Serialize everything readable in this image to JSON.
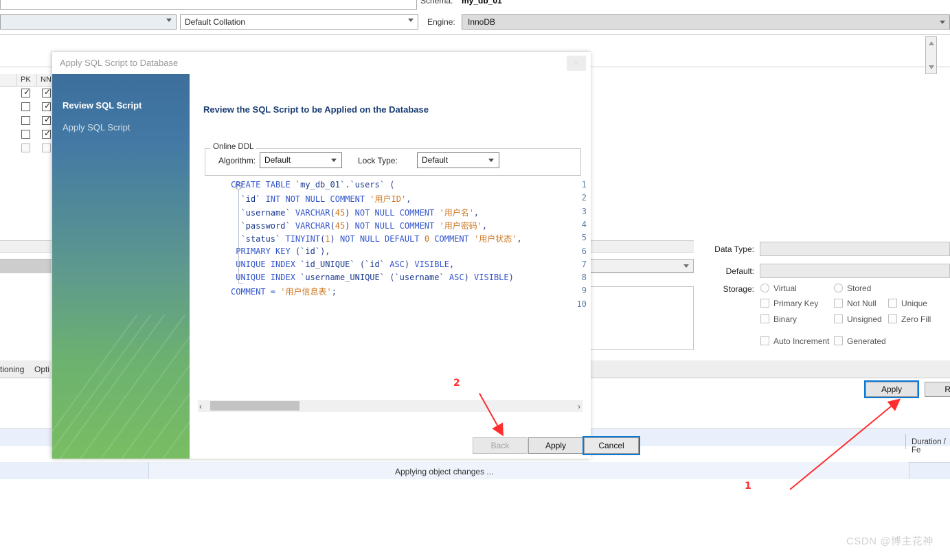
{
  "background_app": {
    "schema_label": "Schema:",
    "schema_value": "my_db_01",
    "engine_label": "Engine:",
    "engine_value": "InnoDB",
    "collation_value": "Default Collation",
    "grid": {
      "headers": [
        "PK",
        "NN"
      ],
      "rows": [
        {
          "pk": true,
          "nn": true,
          "dim": false
        },
        {
          "pk": false,
          "nn": true,
          "dim": false
        },
        {
          "pk": false,
          "nn": true,
          "dim": false
        },
        {
          "pk": false,
          "nn": true,
          "dim": false
        },
        {
          "pk": false,
          "nn": false,
          "dim": true
        }
      ]
    },
    "properties": {
      "data_type_label": "Data Type:",
      "data_type_value": "",
      "default_label": "Default:",
      "default_value": "",
      "storage_label": "Storage:",
      "radios": [
        "Virtual",
        "Stored"
      ],
      "checkboxes": [
        "Primary Key",
        "Not Null",
        "Unique",
        "Binary",
        "Unsigned",
        "Zero Fill",
        "Auto Increment",
        "Generated"
      ]
    },
    "tabs": [
      "tioning",
      "Opti"
    ],
    "apply_button": "Apply",
    "revert_button": "Rev",
    "duration_label": "Duration / Fe",
    "status_text": "Applying object changes ..."
  },
  "dialog": {
    "title": "Apply SQL Script to Database",
    "close_icon": "✕",
    "steps": [
      {
        "label": "Review SQL Script",
        "active": true
      },
      {
        "label": "Apply SQL Script",
        "active": false
      }
    ],
    "heading": "Review the SQL Script to be Applied on the Database",
    "online_ddl": {
      "legend": "Online DDL",
      "algorithm_label": "Algorithm:",
      "algorithm_value": "Default",
      "lock_type_label": "Lock Type:",
      "lock_type_value": "Default"
    },
    "code": {
      "line_numbers": [
        "1",
        "2",
        "3",
        "4",
        "5",
        "6",
        "7",
        "8",
        "9",
        "10"
      ],
      "lines": [
        [
          {
            "t": "CREATE TABLE ",
            "c": "kw"
          },
          {
            "t": "`my_db_01`",
            "c": "id"
          },
          {
            "t": ".",
            "c": "pl"
          },
          {
            "t": "`users`",
            "c": "id"
          },
          {
            "t": " (",
            "c": "pl"
          }
        ],
        [
          {
            "t": "  `id` ",
            "c": "id"
          },
          {
            "t": "INT NOT NULL COMMENT ",
            "c": "kw"
          },
          {
            "t": "'用户ID'",
            "c": "str"
          },
          {
            "t": ",",
            "c": "pl"
          }
        ],
        [
          {
            "t": "  `username` ",
            "c": "id"
          },
          {
            "t": "VARCHAR",
            "c": "kw"
          },
          {
            "t": "(",
            "c": "pl"
          },
          {
            "t": "45",
            "c": "num"
          },
          {
            "t": ")",
            "c": "pl"
          },
          {
            "t": " NOT NULL COMMENT ",
            "c": "kw"
          },
          {
            "t": "'用户名'",
            "c": "str"
          },
          {
            "t": ",",
            "c": "pl"
          }
        ],
        [
          {
            "t": "  `password` ",
            "c": "id"
          },
          {
            "t": "VARCHAR",
            "c": "kw"
          },
          {
            "t": "(",
            "c": "pl"
          },
          {
            "t": "45",
            "c": "num"
          },
          {
            "t": ")",
            "c": "pl"
          },
          {
            "t": " NOT NULL COMMENT ",
            "c": "kw"
          },
          {
            "t": "'用户密码'",
            "c": "str"
          },
          {
            "t": ",",
            "c": "pl"
          }
        ],
        [
          {
            "t": "  `status` ",
            "c": "id"
          },
          {
            "t": "TINYINT",
            "c": "kw"
          },
          {
            "t": "(",
            "c": "pl"
          },
          {
            "t": "1",
            "c": "num"
          },
          {
            "t": ")",
            "c": "pl"
          },
          {
            "t": " NOT NULL DEFAULT ",
            "c": "kw"
          },
          {
            "t": "0",
            "c": "num"
          },
          {
            "t": " COMMENT ",
            "c": "kw"
          },
          {
            "t": "'用户状态'",
            "c": "str"
          },
          {
            "t": ",",
            "c": "pl"
          }
        ],
        [
          {
            "t": " PRIMARY KEY ",
            "c": "kw"
          },
          {
            "t": "(",
            "c": "pl"
          },
          {
            "t": "`id`",
            "c": "id"
          },
          {
            "t": "),",
            "c": "pl"
          }
        ],
        [
          {
            "t": " UNIQUE INDEX ",
            "c": "kw"
          },
          {
            "t": "`id_UNIQUE`",
            "c": "id"
          },
          {
            "t": " (",
            "c": "pl"
          },
          {
            "t": "`id`",
            "c": "id"
          },
          {
            "t": " ASC",
            "c": "kw"
          },
          {
            "t": ") ",
            "c": "pl"
          },
          {
            "t": "VISIBLE",
            "c": "kw"
          },
          {
            "t": ",",
            "c": "pl"
          }
        ],
        [
          {
            "t": " UNIQUE INDEX ",
            "c": "kw"
          },
          {
            "t": "`username_UNIQUE`",
            "c": "id"
          },
          {
            "t": " (",
            "c": "pl"
          },
          {
            "t": "`username`",
            "c": "id"
          },
          {
            "t": " ASC",
            "c": "kw"
          },
          {
            "t": ") ",
            "c": "pl"
          },
          {
            "t": "VISIBLE",
            "c": "kw"
          },
          {
            "t": ")",
            "c": "pl"
          }
        ],
        [
          {
            "t": "COMMENT = ",
            "c": "kw"
          },
          {
            "t": "'用户信息表'",
            "c": "str"
          },
          {
            "t": ";",
            "c": "pl"
          }
        ],
        []
      ]
    },
    "buttons": {
      "back": "Back",
      "apply": "Apply",
      "cancel": "Cancel"
    }
  },
  "annotations": [
    {
      "number": "1"
    },
    {
      "number": "2"
    }
  ],
  "watermark": "CSDN @博主花神",
  "colors": {
    "accent_blue": "#0a7ad6",
    "sidebar_top": "#3d6f9c",
    "sidebar_bottom": "#79bd63",
    "annotation_red": "#ff2d2d",
    "keyword": "#3355cc",
    "string": "#cc7722"
  }
}
